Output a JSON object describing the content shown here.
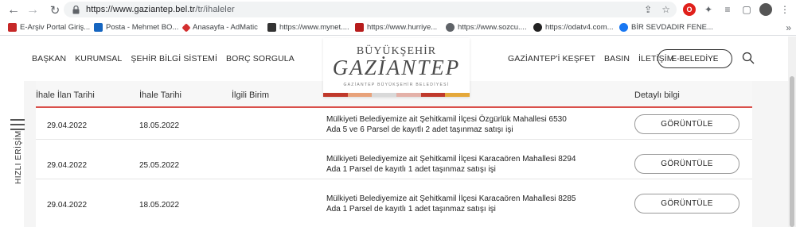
{
  "browser": {
    "url_host": "https://www.gaziantep.bel.tr",
    "url_path": "/tr/ihaleler",
    "ext_opera": "O"
  },
  "bookmarks": [
    {
      "label": "E-Arşiv Portal Giriş...",
      "color": "#c62828"
    },
    {
      "label": "Posta - Mehmet BO...",
      "color": "#1565c0"
    },
    {
      "label": "Anasayfa - AdMatic",
      "color": "#d32f2f"
    },
    {
      "label": "https://www.mynet....",
      "color": "#333333"
    },
    {
      "label": "https://www.hurriye...",
      "color": "#b71c1c"
    },
    {
      "label": "https://www.sozcu....",
      "color": "#5f6368"
    },
    {
      "label": "https://odatv4.com...",
      "color": "#222222"
    },
    {
      "label": "BİR SEVDADIR FENE...",
      "color": "#1877f2"
    }
  ],
  "header": {
    "nav_left": [
      "BAŞKAN",
      "KURUMSAL",
      "ŞEHİR BİLGİ SİSTEMİ",
      "BORÇ SORGULA"
    ],
    "nav_right": [
      "GAZİANTEP'İ KEŞFET",
      "BASIN",
      "İLETİŞİM"
    ],
    "ebelediye": "E-BELEDİYE",
    "logo_top": "BÜYÜKŞEHİR",
    "logo_main": "GAZİANTEP",
    "logo_sub": "GAZİANTEP BÜYÜKŞEHİR BELEDİYESİ"
  },
  "quick_access": "HIZLI ERİŞİM",
  "table": {
    "headers": [
      "İhale İlan Tarihi",
      "İhale Tarihi",
      "İlgili Birim",
      "Detaylı bilgi"
    ],
    "rows": [
      {
        "ilan": "29.04.2022",
        "ihale": "18.05.2022",
        "desc1": "Mülkiyeti Belediyemize ait Şehitkamil İlçesi Özgürlük Mahallesi 6530",
        "desc2": "Ada 5 ve 6 Parsel de kayıtlı 2 adet taşınmaz satışı işi",
        "button": "GÖRÜNTÜLE"
      },
      {
        "ilan": "29.04.2022",
        "ihale": "25.05.2022",
        "desc1": "Mülkiyeti Belediyemize ait Şehitkamil İlçesi Karacaören Mahallesi 8294",
        "desc2": "Ada 1 Parsel de kayıtlı 1 adet taşınmaz satışı işi",
        "button": "GÖRÜNTÜLE"
      },
      {
        "ilan": "29.04.2022",
        "ihale": "18.05.2022",
        "desc1": "Mülkiyeti Belediyemize ait Şehitkamil İlçesi Karacaören Mahallesi 8285",
        "desc2": "Ada 1 Parsel de kayıtlı 1 adet taşınmaz satışı işi",
        "button": "GÖRÜNTÜLE"
      }
    ]
  },
  "colors": {
    "accent": "#d9504b"
  }
}
